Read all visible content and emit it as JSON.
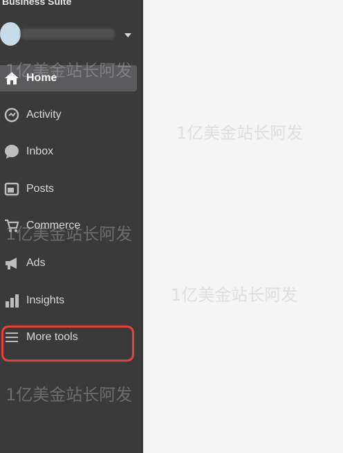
{
  "app": {
    "brand_title": "Business Suite"
  },
  "account": {
    "name": ""
  },
  "nav": {
    "items": [
      {
        "label": "Home",
        "icon": "home-icon",
        "active": true
      },
      {
        "label": "Activity",
        "icon": "activity-icon",
        "active": false
      },
      {
        "label": "Inbox",
        "icon": "inbox-icon",
        "active": false
      },
      {
        "label": "Posts",
        "icon": "posts-icon",
        "active": false
      },
      {
        "label": "Commerce",
        "icon": "shopping-cart-icon",
        "active": false
      },
      {
        "label": "Ads",
        "icon": "megaphone-icon",
        "active": false
      },
      {
        "label": "Insights",
        "icon": "bar-chart-icon",
        "active": false
      },
      {
        "label": "More tools",
        "icon": "menu-icon",
        "active": false
      }
    ]
  },
  "watermark": {
    "text": "1亿美金站长阿发"
  },
  "colors": {
    "sidebar_bg": "#3b3a3b",
    "active_item_bg": "#5b5a5c",
    "highlight": "#e8403a",
    "main_bg": "#f5f5f5"
  }
}
